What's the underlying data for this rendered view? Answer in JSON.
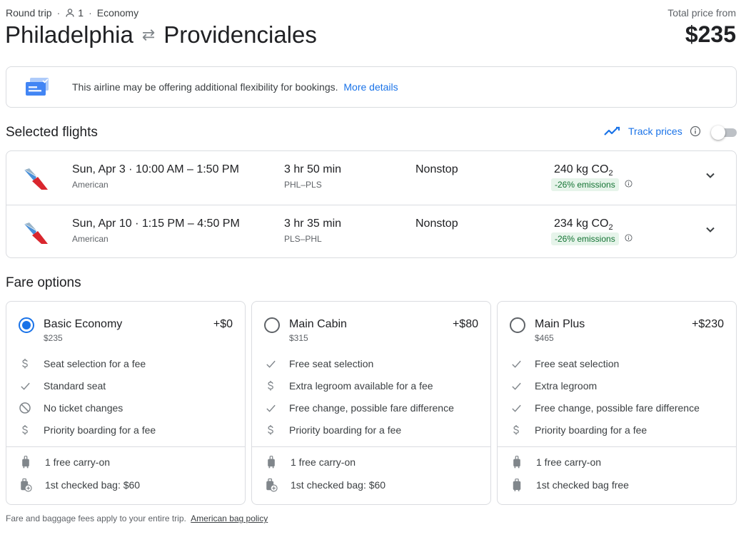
{
  "header": {
    "trip_type": "Round trip",
    "passengers": "1",
    "cabin": "Economy",
    "origin": "Philadelphia",
    "destination": "Providenciales",
    "total_label": "Total price from",
    "total_price": "$235"
  },
  "banner": {
    "text": "This airline may be offering additional flexibility for bookings.",
    "link": "More details"
  },
  "selected": {
    "title": "Selected flights",
    "track_label": "Track prices",
    "track_enabled": false,
    "flights": [
      {
        "date_time": "Sun, Apr 3 · 10:00 AM – 1:50 PM",
        "airline": "American",
        "duration": "3 hr 50 min",
        "codes": "PHL–PLS",
        "stops": "Nonstop",
        "co2": "240 kg CO",
        "emissions": "-26% emissions"
      },
      {
        "date_time": "Sun, Apr 10 · 1:15 PM – 4:50 PM",
        "airline": "American",
        "duration": "3 hr 35 min",
        "codes": "PLS–PHL",
        "stops": "Nonstop",
        "co2": "234 kg CO",
        "emissions": "-26% emissions"
      }
    ]
  },
  "fares": {
    "title": "Fare options",
    "cards": [
      {
        "name": "Basic Economy",
        "price": "$235",
        "delta": "+$0",
        "selected": true,
        "features": [
          {
            "icon": "dollar-icon",
            "text": "Seat selection for a fee"
          },
          {
            "icon": "check-icon",
            "text": "Standard seat"
          },
          {
            "icon": "no-icon",
            "text": "No ticket changes"
          },
          {
            "icon": "dollar-icon",
            "text": "Priority boarding for a fee"
          }
        ],
        "bags": [
          {
            "icon": "carry-on-icon",
            "text": "1 free carry-on"
          },
          {
            "icon": "checked-bag-fee-icon",
            "text": "1st checked bag: $60"
          }
        ]
      },
      {
        "name": "Main Cabin",
        "price": "$315",
        "delta": "+$80",
        "selected": false,
        "features": [
          {
            "icon": "check-icon",
            "text": "Free seat selection"
          },
          {
            "icon": "dollar-icon",
            "text": "Extra legroom available for a fee"
          },
          {
            "icon": "check-icon",
            "text": "Free change, possible fare difference"
          },
          {
            "icon": "dollar-icon",
            "text": "Priority boarding for a fee"
          }
        ],
        "bags": [
          {
            "icon": "carry-on-icon",
            "text": "1 free carry-on"
          },
          {
            "icon": "checked-bag-fee-icon",
            "text": "1st checked bag: $60"
          }
        ]
      },
      {
        "name": "Main Plus",
        "price": "$465",
        "delta": "+$230",
        "selected": false,
        "features": [
          {
            "icon": "check-icon",
            "text": "Free seat selection"
          },
          {
            "icon": "check-icon",
            "text": "Extra legroom"
          },
          {
            "icon": "check-icon",
            "text": "Free change, possible fare difference"
          },
          {
            "icon": "dollar-icon",
            "text": "Priority boarding for a fee"
          }
        ],
        "bags": [
          {
            "icon": "carry-on-icon",
            "text": "1 free carry-on"
          },
          {
            "icon": "checked-bag-icon",
            "text": "1st checked bag free"
          }
        ]
      }
    ]
  },
  "footnote": {
    "text": "Fare and baggage fees apply to your entire trip.",
    "link": "American bag policy"
  },
  "colors": {
    "accent": "#1a73e8",
    "emissions_bg": "#e6f4ea",
    "emissions_fg": "#137333",
    "border": "#dadce0"
  }
}
